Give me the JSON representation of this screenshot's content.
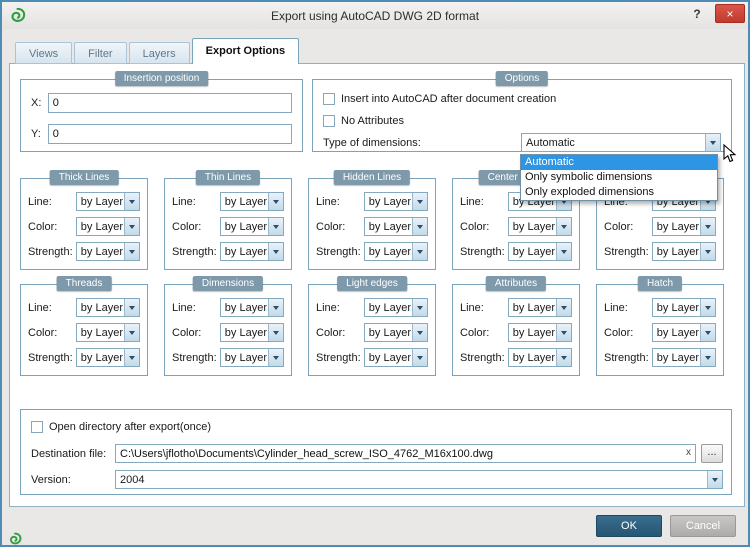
{
  "window": {
    "title": "Export using AutoCAD DWG 2D format",
    "help": "?",
    "close": "×"
  },
  "tabs": [
    "Views",
    "Filter",
    "Layers",
    "Export Options"
  ],
  "insertion": {
    "header": "Insertion position",
    "x_label": "X:",
    "x_value": "0",
    "y_label": "Y:",
    "y_value": "0"
  },
  "options": {
    "header": "Options",
    "insert_checkbox": "Insert into AutoCAD after document creation",
    "no_attributes_checkbox": "No Attributes",
    "dims_label": "Type of dimensions:",
    "dims_value": "Automatic",
    "dropdown_items": [
      "Automatic",
      "Only symbolic dimensions",
      "Only exploded dimensions"
    ]
  },
  "line_groups_row1": [
    "Thick Lines",
    "Thin Lines",
    "Hidden Lines",
    "Center Lines"
  ],
  "line_groups_row2": [
    "Threads",
    "Dimensions",
    "Light edges",
    "Attributes",
    "Hatch"
  ],
  "combo_rows": [
    "Line:",
    "Color:",
    "Strength:"
  ],
  "combo_value": "by Layer",
  "export": {
    "open_dir_checkbox": "Open directory after export(once)",
    "dest_label": "Destination file:",
    "dest_value": "C:\\Users\\jflotho\\Documents\\Cylinder_head_screw_ISO_4762_M16x100.dwg",
    "clear": "x",
    "browse": "...",
    "version_label": "Version:",
    "version_value": "2004"
  },
  "buttons": {
    "ok": "OK",
    "cancel": "Cancel"
  }
}
